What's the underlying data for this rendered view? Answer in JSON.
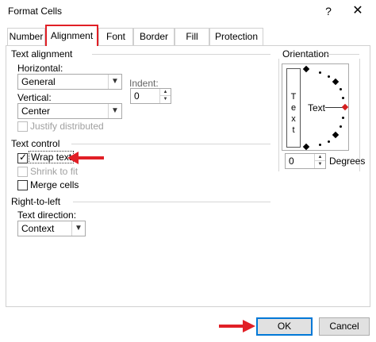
{
  "window": {
    "title": "Format Cells",
    "help_glyph": "?",
    "close_glyph": "✕"
  },
  "tabs": [
    {
      "label": "Number"
    },
    {
      "label": "Alignment"
    },
    {
      "label": "Font"
    },
    {
      "label": "Border"
    },
    {
      "label": "Fill"
    },
    {
      "label": "Protection"
    }
  ],
  "text_alignment": {
    "section": "Text alignment",
    "horizontal_label": "Horizontal:",
    "horizontal_value": "General",
    "vertical_label": "Vertical:",
    "vertical_value": "Center",
    "indent_label": "Indent:",
    "indent_value": "0",
    "justify_distributed": "Justify distributed"
  },
  "text_control": {
    "section": "Text control",
    "wrap_text": "Wrap text",
    "shrink_to_fit": "Shrink to fit",
    "merge_cells": "Merge cells"
  },
  "rtl": {
    "section": "Right-to-left",
    "direction_label": "Text direction:",
    "direction_value": "Context"
  },
  "orientation": {
    "section": "Orientation",
    "vertical_text": "Text",
    "dial_text": "Text",
    "degrees_value": "0",
    "degrees_label": "Degrees"
  },
  "buttons": {
    "ok": "OK",
    "cancel": "Cancel"
  },
  "colors": {
    "highlight": "#e11f26",
    "focus": "#0078d7",
    "disabled": "#a0a0a0"
  }
}
